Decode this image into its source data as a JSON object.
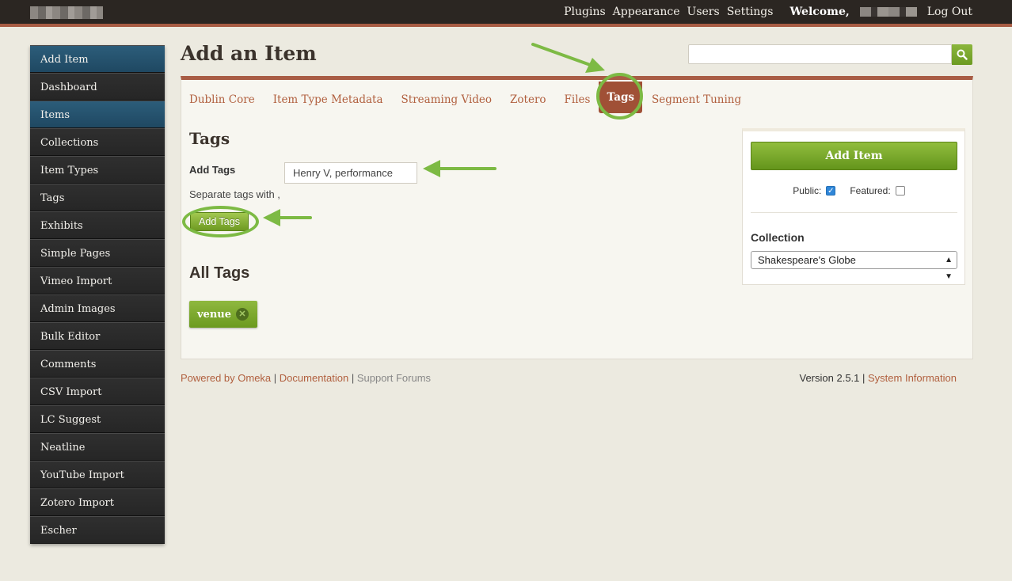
{
  "topbar": {
    "nav": [
      "Plugins",
      "Appearance",
      "Users",
      "Settings"
    ],
    "welcome": "Welcome,",
    "logout": "Log Out"
  },
  "sidebar": {
    "items": [
      {
        "label": "Add Item",
        "active": true
      },
      {
        "label": "Dashboard",
        "active": false
      },
      {
        "label": "Items",
        "active": true
      },
      {
        "label": "Collections",
        "active": false
      },
      {
        "label": "Item Types",
        "active": false
      },
      {
        "label": "Tags",
        "active": false
      },
      {
        "label": "Exhibits",
        "active": false
      },
      {
        "label": "Simple Pages",
        "active": false
      },
      {
        "label": "Vimeo Import",
        "active": false
      },
      {
        "label": "Admin Images",
        "active": false
      },
      {
        "label": "Bulk Editor",
        "active": false
      },
      {
        "label": "Comments",
        "active": false
      },
      {
        "label": "CSV Import",
        "active": false
      },
      {
        "label": "LC Suggest",
        "active": false
      },
      {
        "label": "Neatline",
        "active": false
      },
      {
        "label": "YouTube Import",
        "active": false
      },
      {
        "label": "Zotero Import",
        "active": false
      },
      {
        "label": "Escher",
        "active": false
      }
    ]
  },
  "page": {
    "title": "Add an Item",
    "search_value": ""
  },
  "tabs": [
    {
      "label": "Dublin Core",
      "active": false
    },
    {
      "label": "Item Type Metadata",
      "active": false
    },
    {
      "label": "Streaming Video",
      "active": false
    },
    {
      "label": "Zotero",
      "active": false
    },
    {
      "label": "Files",
      "active": false
    },
    {
      "label": "Tags",
      "active": true
    },
    {
      "label": "Segment Tuning",
      "active": false
    }
  ],
  "tags_section": {
    "title": "Tags",
    "add_label": "Add Tags",
    "input_value": "Henry V, performance",
    "separator_note": "Separate tags with ,",
    "add_button": "Add Tags",
    "all_tags_title": "All Tags",
    "tags": [
      "venue"
    ]
  },
  "save_panel": {
    "add_item_button": "Add Item",
    "public_label": "Public:",
    "public_checked": true,
    "featured_label": "Featured:",
    "featured_checked": false,
    "collection_label": "Collection",
    "collection_value": "Shakespeare's Globe"
  },
  "footer": {
    "powered_by": "Powered by Omeka",
    "documentation": "Documentation",
    "support": "Support Forums",
    "version": "Version 2.5.1",
    "system_info": "System Information"
  },
  "colors": {
    "accent_brown": "#a85c44",
    "green": "#7dba44",
    "sidebar_active": "#2c5d7a"
  }
}
